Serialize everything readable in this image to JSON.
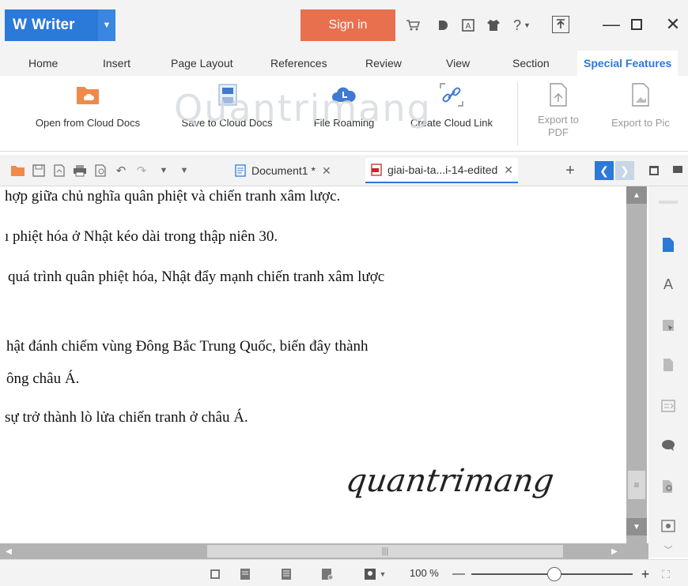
{
  "app": {
    "logo": "W",
    "name": "Writer"
  },
  "titlebar": {
    "signin_label": "Sign in",
    "help_label": "?"
  },
  "ribbon_tabs": [
    {
      "label": "Home"
    },
    {
      "label": "Insert"
    },
    {
      "label": "Page Layout"
    },
    {
      "label": "References"
    },
    {
      "label": "Review"
    },
    {
      "label": "View"
    },
    {
      "label": "Section"
    },
    {
      "label": "Special Features",
      "active": true
    }
  ],
  "ribbon": {
    "open_cloud": "Open from Cloud Docs",
    "save_cloud": "Save to Cloud Docs",
    "file_roaming": "File Roaming",
    "create_link": "Create Cloud Link",
    "export_pdf_1": "Export to",
    "export_pdf_2": "PDF",
    "export_pic": "Export to Pic"
  },
  "watermark": "Quantrimang",
  "doc_tabs": [
    {
      "label": "Document1 *"
    },
    {
      "label": "giai-bai-ta...i-14-edited",
      "active": true
    }
  ],
  "document": {
    "lines": [
      "hợp giữa chủ nghĩa quân phiệt và chiến tranh xâm lược.",
      "ı phiệt hóa ở Nhật kéo dài trong thập niên 30.",
      "quá trình quân phiệt hóa, Nhật đẩy mạnh chiến tranh xâm lược",
      "hật đánh chiếm vùng Đông Bắc Trung Quốc, biến đây thành",
      "ông châu Á.",
      " sự trở thành lò lửa chiến tranh ở châu Á."
    ],
    "signature": "quantrimang"
  },
  "statusbar": {
    "zoom_label": "100 %",
    "zoom_percent": 100
  },
  "colors": {
    "accent": "#2b79d8",
    "signin": "#e8704f",
    "cloud_folder": "#f08a4b"
  }
}
